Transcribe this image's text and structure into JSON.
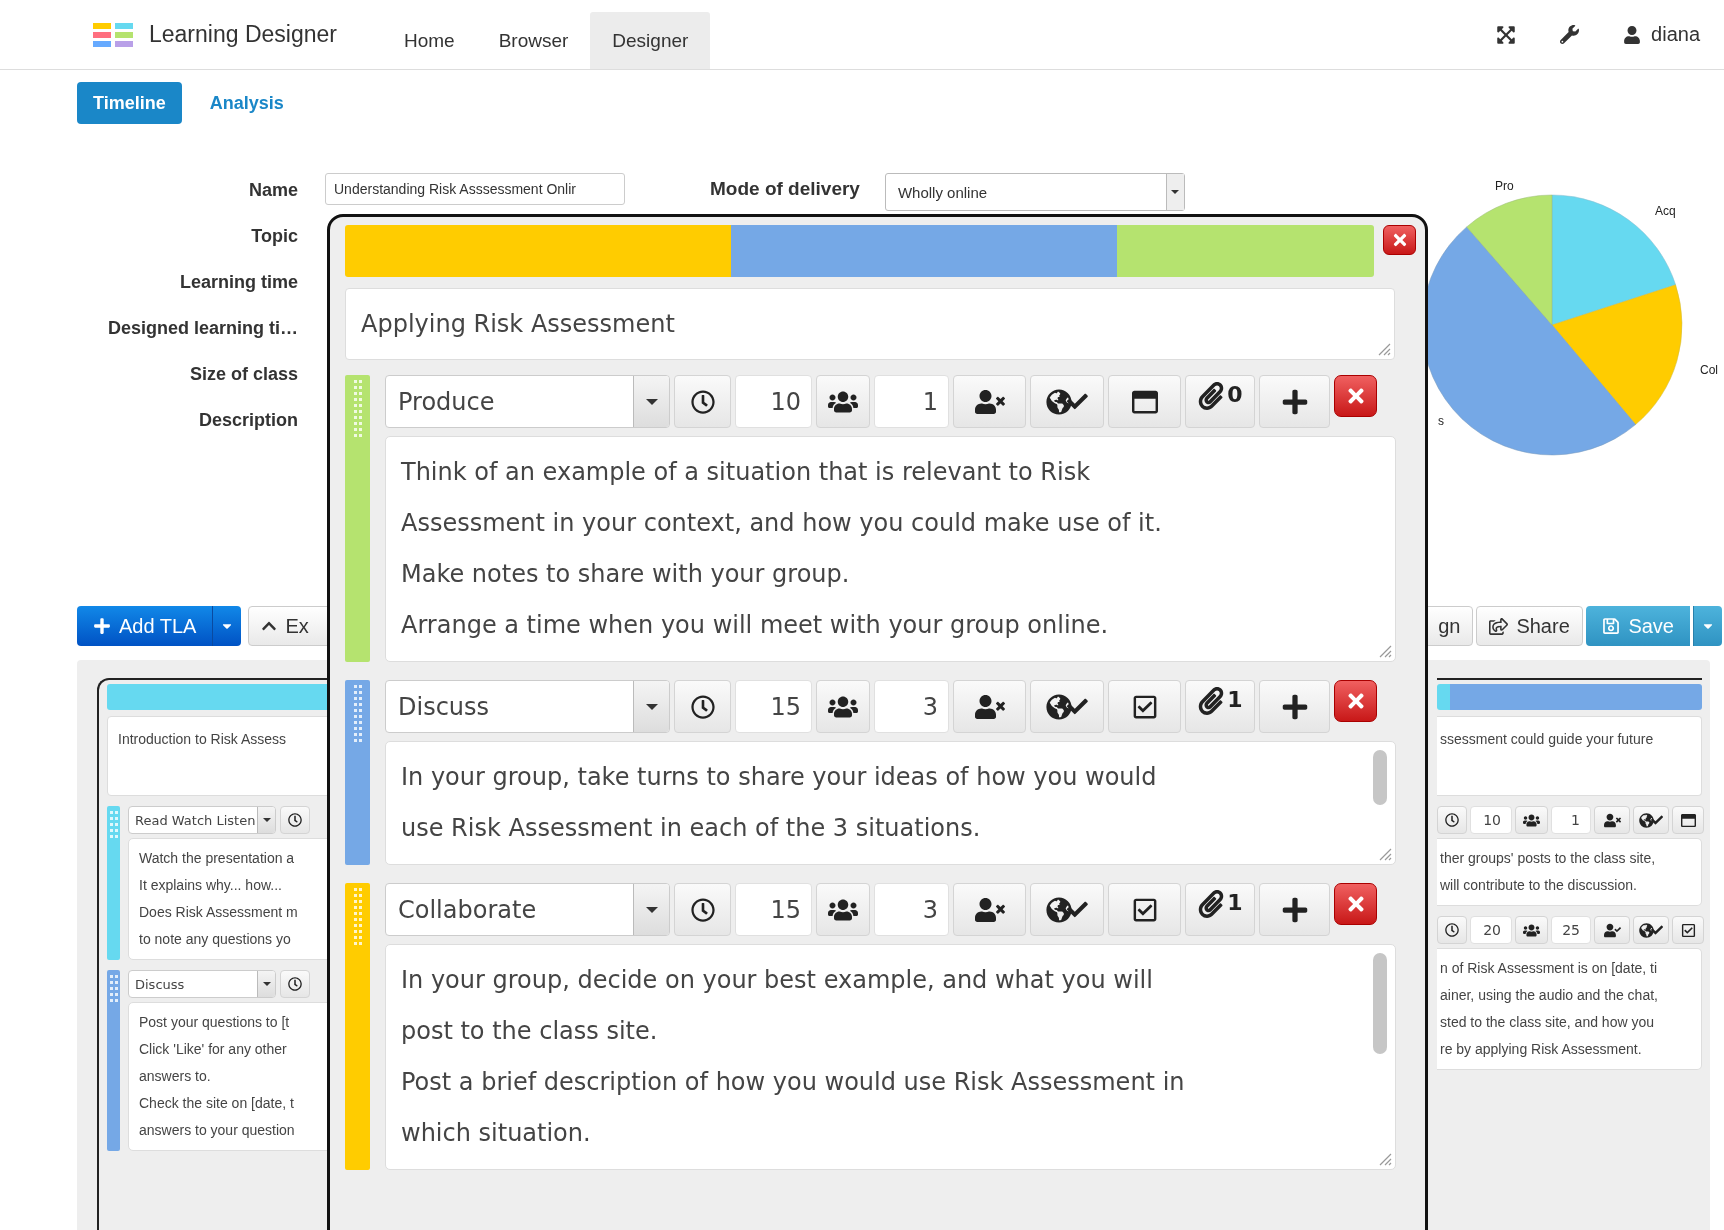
{
  "nav": {
    "brand": "Learning Designer",
    "links": [
      {
        "label": "Home",
        "selected": false
      },
      {
        "label": "Browser",
        "selected": false
      },
      {
        "label": "Designer",
        "selected": true
      }
    ],
    "user": "diana"
  },
  "view_tabs": [
    {
      "label": "Timeline",
      "selected": true
    },
    {
      "label": "Analysis",
      "selected": false
    }
  ],
  "form": {
    "labels": [
      "Name",
      "Topic",
      "Learning time",
      "Designed learning ti…",
      "Size of class",
      "Description"
    ],
    "name_value": "Understanding Risk Asssessment Onlir",
    "mode_label": "Mode of delivery",
    "mode_value": "Wholly online"
  },
  "pie": {
    "labels": [
      "Pro",
      "Acq",
      "Col",
      "s"
    ]
  },
  "toolbar": {
    "add_label": "Add TLA",
    "expand_label": "Ex",
    "design_label": "gn",
    "share_label": "Share",
    "save_label": "Save"
  },
  "left_card": {
    "bar": [
      {
        "color": "#66d9f0",
        "level": 1
      }
    ],
    "title": "Introduction to Risk Assess",
    "activities": [
      {
        "type": "Read Watch Listen",
        "color": "#66d9f0",
        "lines": [
          "Watch the presentation a",
          "It explains why... how...",
          "Does Risk Assessment m",
          "to note any questions yo"
        ]
      },
      {
        "type": "Discuss",
        "color": "#75a8e6",
        "lines": [
          "Post your questions to [t",
          "Click 'Like' for any other",
          "answers to.",
          "Check the site on [date, t",
          "answers to your question"
        ]
      }
    ]
  },
  "right_card": {
    "bar": [
      {
        "color": "#66d9f0",
        "level": 0.05
      },
      {
        "color": "#75a8e6",
        "level": 0.95
      }
    ],
    "title": "ssessment could guide your future",
    "activities": [
      {
        "minutes": "10",
        "group": "1",
        "person_checked": false,
        "sheet_checked": false,
        "lines": [
          "ther groups' posts to the class site,",
          "will contribute to the discussion."
        ]
      },
      {
        "minutes": "20",
        "group": "25",
        "person_checked": true,
        "sheet_checked": true,
        "lines": [
          "n of Risk Assessment is on [date, ti",
          "ainer, using the audio and the chat,",
          "sted to the class site, and how you",
          "re by applying Risk Assessment."
        ]
      }
    ]
  },
  "popup": {
    "title": "Applying Risk Assessment",
    "activities": [
      {
        "type": "Produce",
        "color": "#b5e36f",
        "minutes": "10",
        "group": "1",
        "person_checked": false,
        "sheet_checked": false,
        "resources": "0",
        "scrollable": false,
        "lines": [
          "Think of an example of a situation that is relevant to Risk",
          "Assessment in your context, and how you could make use of it.",
          "Make notes to share with your group.",
          "Arrange a time when you will meet with your group online."
        ]
      },
      {
        "type": "Discuss",
        "color": "#75a8e6",
        "minutes": "15",
        "group": "3",
        "person_checked": false,
        "sheet_checked": true,
        "resources": "1",
        "scrollable": true,
        "lines": [
          "In your group, take turns to share your ideas of how you would",
          "use Risk Assessment in each of the 3 situations."
        ]
      },
      {
        "type": "Collaborate",
        "color": "#ffcc00",
        "minutes": "15",
        "group": "3",
        "person_checked": false,
        "sheet_checked": true,
        "resources": "1",
        "scrollable": true,
        "lines": [
          "In your group, decide on your best example, and what you will",
          "post to the class site.",
          "Post a brief description of how you would use Risk Assessment in",
          "which situation."
        ]
      }
    ]
  }
}
